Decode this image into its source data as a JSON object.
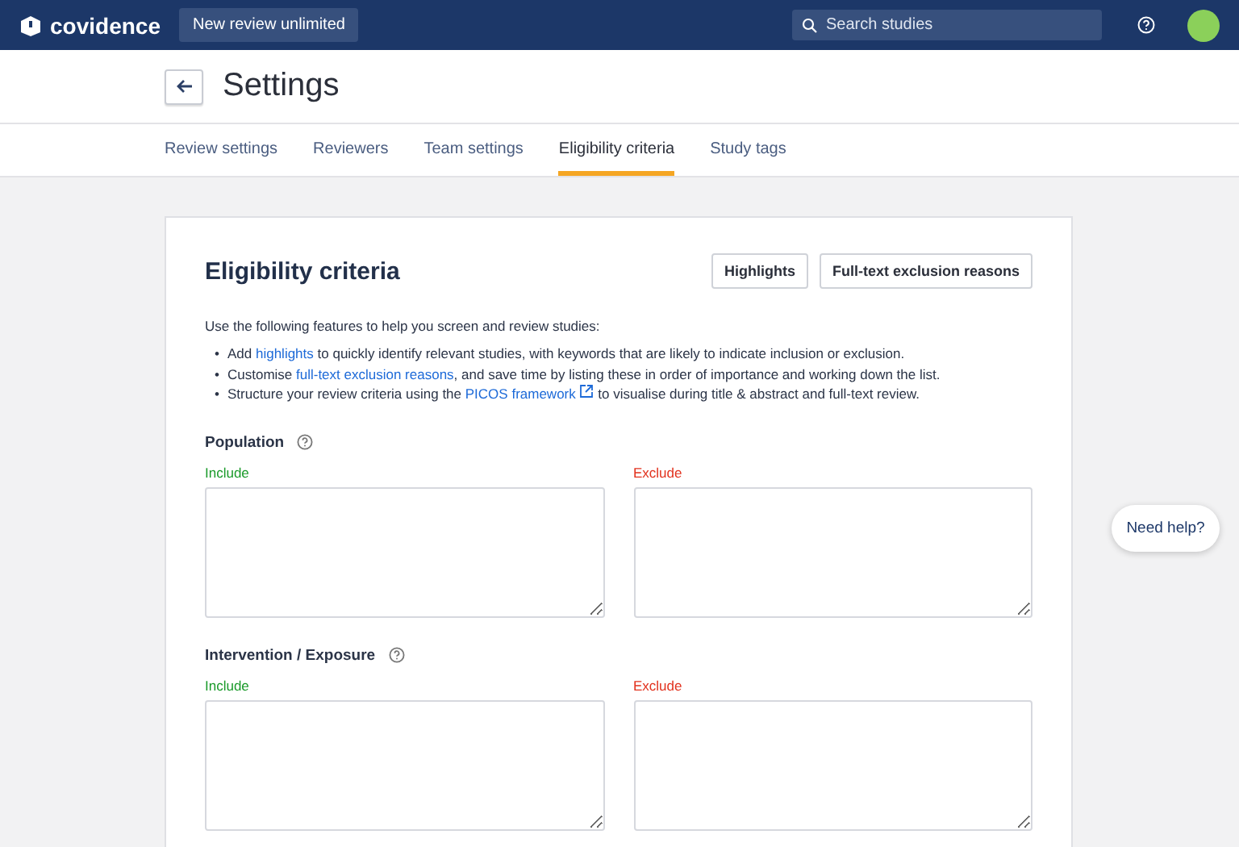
{
  "header": {
    "logo": "covidence",
    "project_button": "New review unlimited",
    "search": {
      "placeholder": "Search studies"
    }
  },
  "page": {
    "title": "Settings"
  },
  "tabs": [
    {
      "label": "Review settings",
      "selected": false
    },
    {
      "label": "Reviewers",
      "selected": false
    },
    {
      "label": "Team settings",
      "selected": false
    },
    {
      "label": "Eligibility criteria",
      "selected": true
    },
    {
      "label": "Study tags",
      "selected": false
    }
  ],
  "card": {
    "title": "Eligibility criteria",
    "buttons": [
      "Highlights",
      "Full-text exclusion reasons"
    ],
    "intro": "Use the following features to help you screen and review studies:",
    "bullet_marker": "•",
    "bullets": [
      [
        {
          "text": "Add "
        },
        {
          "text": "highlights",
          "kind": "link"
        },
        {
          "text": " to quickly identify relevant studies, with keywords that are likely to indicate inclusion or exclusion."
        }
      ],
      [
        {
          "text": "Customise "
        },
        {
          "text": "full-text exclusion reasons",
          "kind": "link"
        },
        {
          "text": ", and save time by listing these in order of importance and working down the list."
        }
      ],
      [
        {
          "text": "Structure your review criteria using the "
        },
        {
          "text": "PICOS framework",
          "kind": "external-link"
        },
        {
          "text": " to visualise during title & abstract and full-text review."
        }
      ]
    ],
    "sections": [
      {
        "title": "Population",
        "include_label": "Include",
        "exclude_label": "Exclude"
      },
      {
        "title": "Intervention / Exposure",
        "include_label": "Include",
        "exclude_label": "Exclude"
      }
    ]
  },
  "help_button": "Need help?"
}
